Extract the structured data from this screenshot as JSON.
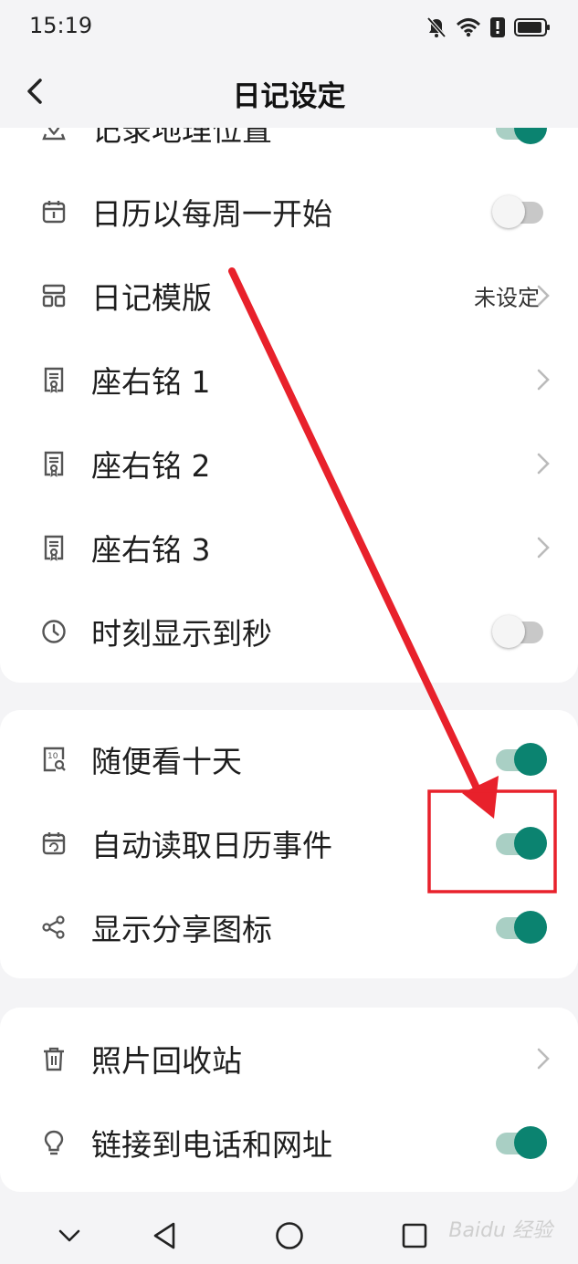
{
  "status_bar": {
    "time": "15:19"
  },
  "header": {
    "title": "日记设定"
  },
  "section1": [
    {
      "label": "记录地理位置",
      "icon": "location-icon",
      "control": "toggle",
      "on": true
    },
    {
      "label": "日历以每周一开始",
      "icon": "calendar-icon",
      "control": "toggle",
      "on": false
    },
    {
      "label": "日记模版",
      "icon": "template-icon",
      "control": "link",
      "value": "未设定"
    },
    {
      "label": "座右铭 1",
      "icon": "certificate-icon",
      "control": "link"
    },
    {
      "label": "座右铭 2",
      "icon": "certificate-icon",
      "control": "link"
    },
    {
      "label": "座右铭 3",
      "icon": "certificate-icon",
      "control": "link"
    },
    {
      "label": "时刻显示到秒",
      "icon": "clock-icon",
      "control": "toggle",
      "on": false
    }
  ],
  "section2": [
    {
      "label": "随便看十天",
      "icon": "ten-days-icon",
      "control": "toggle",
      "on": true
    },
    {
      "label": "自动读取日历事件",
      "icon": "calendar-event-icon",
      "control": "toggle",
      "on": true
    },
    {
      "label": "显示分享图标",
      "icon": "share-icon",
      "control": "toggle",
      "on": true
    }
  ],
  "section3": [
    {
      "label": "照片回收站",
      "icon": "trash-icon",
      "control": "link"
    },
    {
      "label": "链接到电话和网址",
      "icon": "lightbulb-icon",
      "control": "toggle",
      "on": true
    }
  ],
  "watermark": "Baidu 经验",
  "colors": {
    "accent": "#0b8370",
    "annotation": "#e8212b"
  }
}
